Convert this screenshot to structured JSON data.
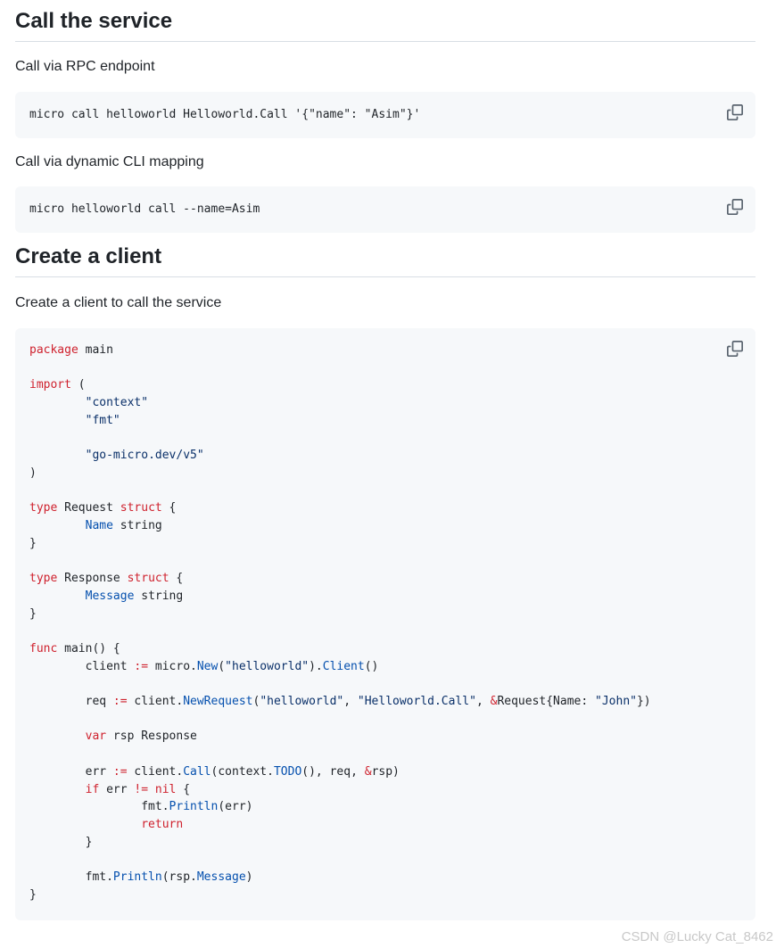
{
  "sections": [
    {
      "heading": "Call the service",
      "paragraphs": [
        "Call via RPC endpoint",
        "Call via dynamic CLI mapping"
      ],
      "commands": [
        "micro call helloworld Helloworld.Call '{\"name\": \"Asim\"}'",
        "micro helloworld call --name=Asim"
      ]
    },
    {
      "heading": "Create a client",
      "paragraph": "Create a client to call the service"
    }
  ],
  "code": {
    "lines": [
      [
        [
          "kw",
          "package"
        ],
        [
          "t",
          " main"
        ]
      ],
      [],
      [
        [
          "kw",
          "import"
        ],
        [
          "t",
          " ("
        ]
      ],
      [
        [
          "t",
          "        "
        ],
        [
          "str",
          "\"context\""
        ]
      ],
      [
        [
          "t",
          "        "
        ],
        [
          "str",
          "\"fmt\""
        ]
      ],
      [],
      [
        [
          "t",
          "        "
        ],
        [
          "str",
          "\"go-micro.dev/v5\""
        ]
      ],
      [
        [
          "t",
          ")"
        ]
      ],
      [],
      [
        [
          "kw",
          "type"
        ],
        [
          "t",
          " Request "
        ],
        [
          "kw",
          "struct"
        ],
        [
          "t",
          " {"
        ]
      ],
      [
        [
          "t",
          "        "
        ],
        [
          "fn",
          "Name"
        ],
        [
          "t",
          " string"
        ]
      ],
      [
        [
          "t",
          "}"
        ]
      ],
      [],
      [
        [
          "kw",
          "type"
        ],
        [
          "t",
          " Response "
        ],
        [
          "kw",
          "struct"
        ],
        [
          "t",
          " {"
        ]
      ],
      [
        [
          "t",
          "        "
        ],
        [
          "fn",
          "Message"
        ],
        [
          "t",
          " string"
        ]
      ],
      [
        [
          "t",
          "}"
        ]
      ],
      [],
      [
        [
          "kw",
          "func"
        ],
        [
          "t",
          " main() {"
        ]
      ],
      [
        [
          "t",
          "        client "
        ],
        [
          "kw",
          ":="
        ],
        [
          "t",
          " micro."
        ],
        [
          "fn",
          "New"
        ],
        [
          "t",
          "("
        ],
        [
          "str",
          "\"helloworld\""
        ],
        [
          "t",
          ")."
        ],
        [
          "fn",
          "Client"
        ],
        [
          "t",
          "()"
        ]
      ],
      [],
      [
        [
          "t",
          "        req "
        ],
        [
          "kw",
          ":="
        ],
        [
          "t",
          " client."
        ],
        [
          "fn",
          "NewRequest"
        ],
        [
          "t",
          "("
        ],
        [
          "str",
          "\"helloworld\""
        ],
        [
          "t",
          ", "
        ],
        [
          "str",
          "\"Helloworld.Call\""
        ],
        [
          "t",
          ", "
        ],
        [
          "kw",
          "&"
        ],
        [
          "t",
          "Request{Name: "
        ],
        [
          "str",
          "\"John\""
        ],
        [
          "t",
          "})"
        ]
      ],
      [],
      [
        [
          "t",
          "        "
        ],
        [
          "kw",
          "var"
        ],
        [
          "t",
          " rsp Response"
        ]
      ],
      [],
      [
        [
          "t",
          "        err "
        ],
        [
          "kw",
          ":="
        ],
        [
          "t",
          " client."
        ],
        [
          "fn",
          "Call"
        ],
        [
          "t",
          "(context."
        ],
        [
          "fn",
          "TODO"
        ],
        [
          "t",
          "(), req, "
        ],
        [
          "kw",
          "&"
        ],
        [
          "t",
          "rsp)"
        ]
      ],
      [
        [
          "t",
          "        "
        ],
        [
          "kw",
          "if"
        ],
        [
          "t",
          " err "
        ],
        [
          "kw",
          "!="
        ],
        [
          "t",
          " "
        ],
        [
          "kw",
          "nil"
        ],
        [
          "t",
          " {"
        ]
      ],
      [
        [
          "t",
          "                fmt."
        ],
        [
          "fn",
          "Println"
        ],
        [
          "t",
          "(err)"
        ]
      ],
      [
        [
          "t",
          "                "
        ],
        [
          "kw",
          "return"
        ]
      ],
      [
        [
          "t",
          "        }"
        ]
      ],
      [],
      [
        [
          "t",
          "        fmt."
        ],
        [
          "fn",
          "Println"
        ],
        [
          "t",
          "(rsp."
        ],
        [
          "fn",
          "Message"
        ],
        [
          "t",
          ")"
        ]
      ],
      [
        [
          "t",
          "}"
        ]
      ]
    ]
  },
  "watermark": "CSDN @Lucky Cat_8462",
  "colors": {
    "keyword": "#cf222e",
    "string": "#0a3069",
    "identifier": "#0550ae",
    "code_bg": "#f6f8fa"
  },
  "icons": {
    "copy": "copy-icon"
  }
}
